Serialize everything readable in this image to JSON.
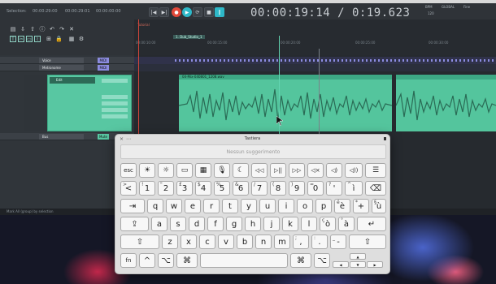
{
  "daw": {
    "selection_label": "Selection:",
    "sel_start": "00:00:29:00",
    "sel_end": "00:00:29:01",
    "sel_len": "00:00:00:00",
    "big_time": "00:00:19:14 / 0:19.623",
    "bpm_label": "BPM",
    "bpm_value": "120",
    "global_label": "GLOBAL",
    "mode_label": "Fine",
    "marker_label": "Tutorial",
    "tab_label": "1. Dub_Studio_1",
    "ruler": [
      "00:00:10:00",
      "00:00:15:00",
      "00:00:20:00",
      "00:00:25:00",
      "00:00:30:00"
    ],
    "tracks": [
      {
        "name": "Voice",
        "tag": "MIDI"
      },
      {
        "name": "Metronome",
        "tag": "MIDI"
      },
      {
        "name": "Edit",
        "tag": "Mute"
      },
      {
        "name": "Bus",
        "tag": "Mute"
      }
    ],
    "clip_name": "04-Mix-040801_1208.wav",
    "status_text": "Mark All (group) by selection"
  },
  "keyboard": {
    "title": "Tastiera",
    "suggestion": "Nessun suggerimento",
    "row_fn": [
      "esc",
      "☀",
      "☼",
      "▭",
      "▦",
      "🎙",
      "☾",
      "◁◁",
      "▷||",
      "▷▷",
      "◁×",
      "◁)",
      "◁))",
      "☰"
    ],
    "row_num": [
      {
        "main": "<",
        "alt": ">",
        "alt2": ""
      },
      {
        "main": "1",
        "alt": "!",
        "alt2": ""
      },
      {
        "main": "2",
        "alt": "\"",
        "alt2": ""
      },
      {
        "main": "3",
        "alt": "£",
        "alt2": ""
      },
      {
        "main": "4",
        "alt": "$",
        "alt2": ""
      },
      {
        "main": "5",
        "alt": "%",
        "alt2": ""
      },
      {
        "main": "6",
        "alt": "&",
        "alt2": ""
      },
      {
        "main": "7",
        "alt": "/",
        "alt2": ""
      },
      {
        "main": "8",
        "alt": "(",
        "alt2": ""
      },
      {
        "main": "9",
        "alt": ")",
        "alt2": ""
      },
      {
        "main": "0",
        "alt": "=",
        "alt2": ""
      },
      {
        "main": "'",
        "alt": "?",
        "alt2": ""
      },
      {
        "main": "ì",
        "alt": "^",
        "alt2": ""
      },
      {
        "main": "⌫",
        "alt": "",
        "alt2": ""
      }
    ],
    "row_q": [
      "⇥",
      "q",
      "w",
      "e",
      "r",
      "t",
      "y",
      "u",
      "i",
      "o",
      "p",
      "è",
      "+",
      "ù"
    ],
    "row_q_alt": [
      "",
      "",
      "",
      "",
      "",
      "",
      "",
      "",
      "",
      "",
      "",
      "é",
      "*",
      "§"
    ],
    "row_a": [
      "⇪",
      "a",
      "s",
      "d",
      "f",
      "g",
      "h",
      "j",
      "k",
      "l",
      "ò",
      "à",
      "↵"
    ],
    "row_a_alt": [
      "",
      "",
      "",
      "",
      "",
      "",
      "",
      "",
      "",
      "",
      "ç",
      "°",
      ""
    ],
    "row_z": [
      "⇧",
      "z",
      "x",
      "c",
      "v",
      "b",
      "n",
      "m",
      ",",
      ".",
      "-",
      "⇧"
    ],
    "row_z_alt": [
      "",
      "",
      "",
      "",
      "",
      "",
      "",
      "",
      ";",
      ":",
      "_",
      ""
    ],
    "row_bottom": {
      "fn": "fn",
      "ctrl": "^",
      "opt_l": "⌥",
      "cmd_l": "⌘",
      "space": "",
      "cmd_r": "⌘",
      "opt_r": "⌥",
      "up": "▲",
      "left": "◀",
      "down": "▼",
      "right": "▶"
    }
  }
}
